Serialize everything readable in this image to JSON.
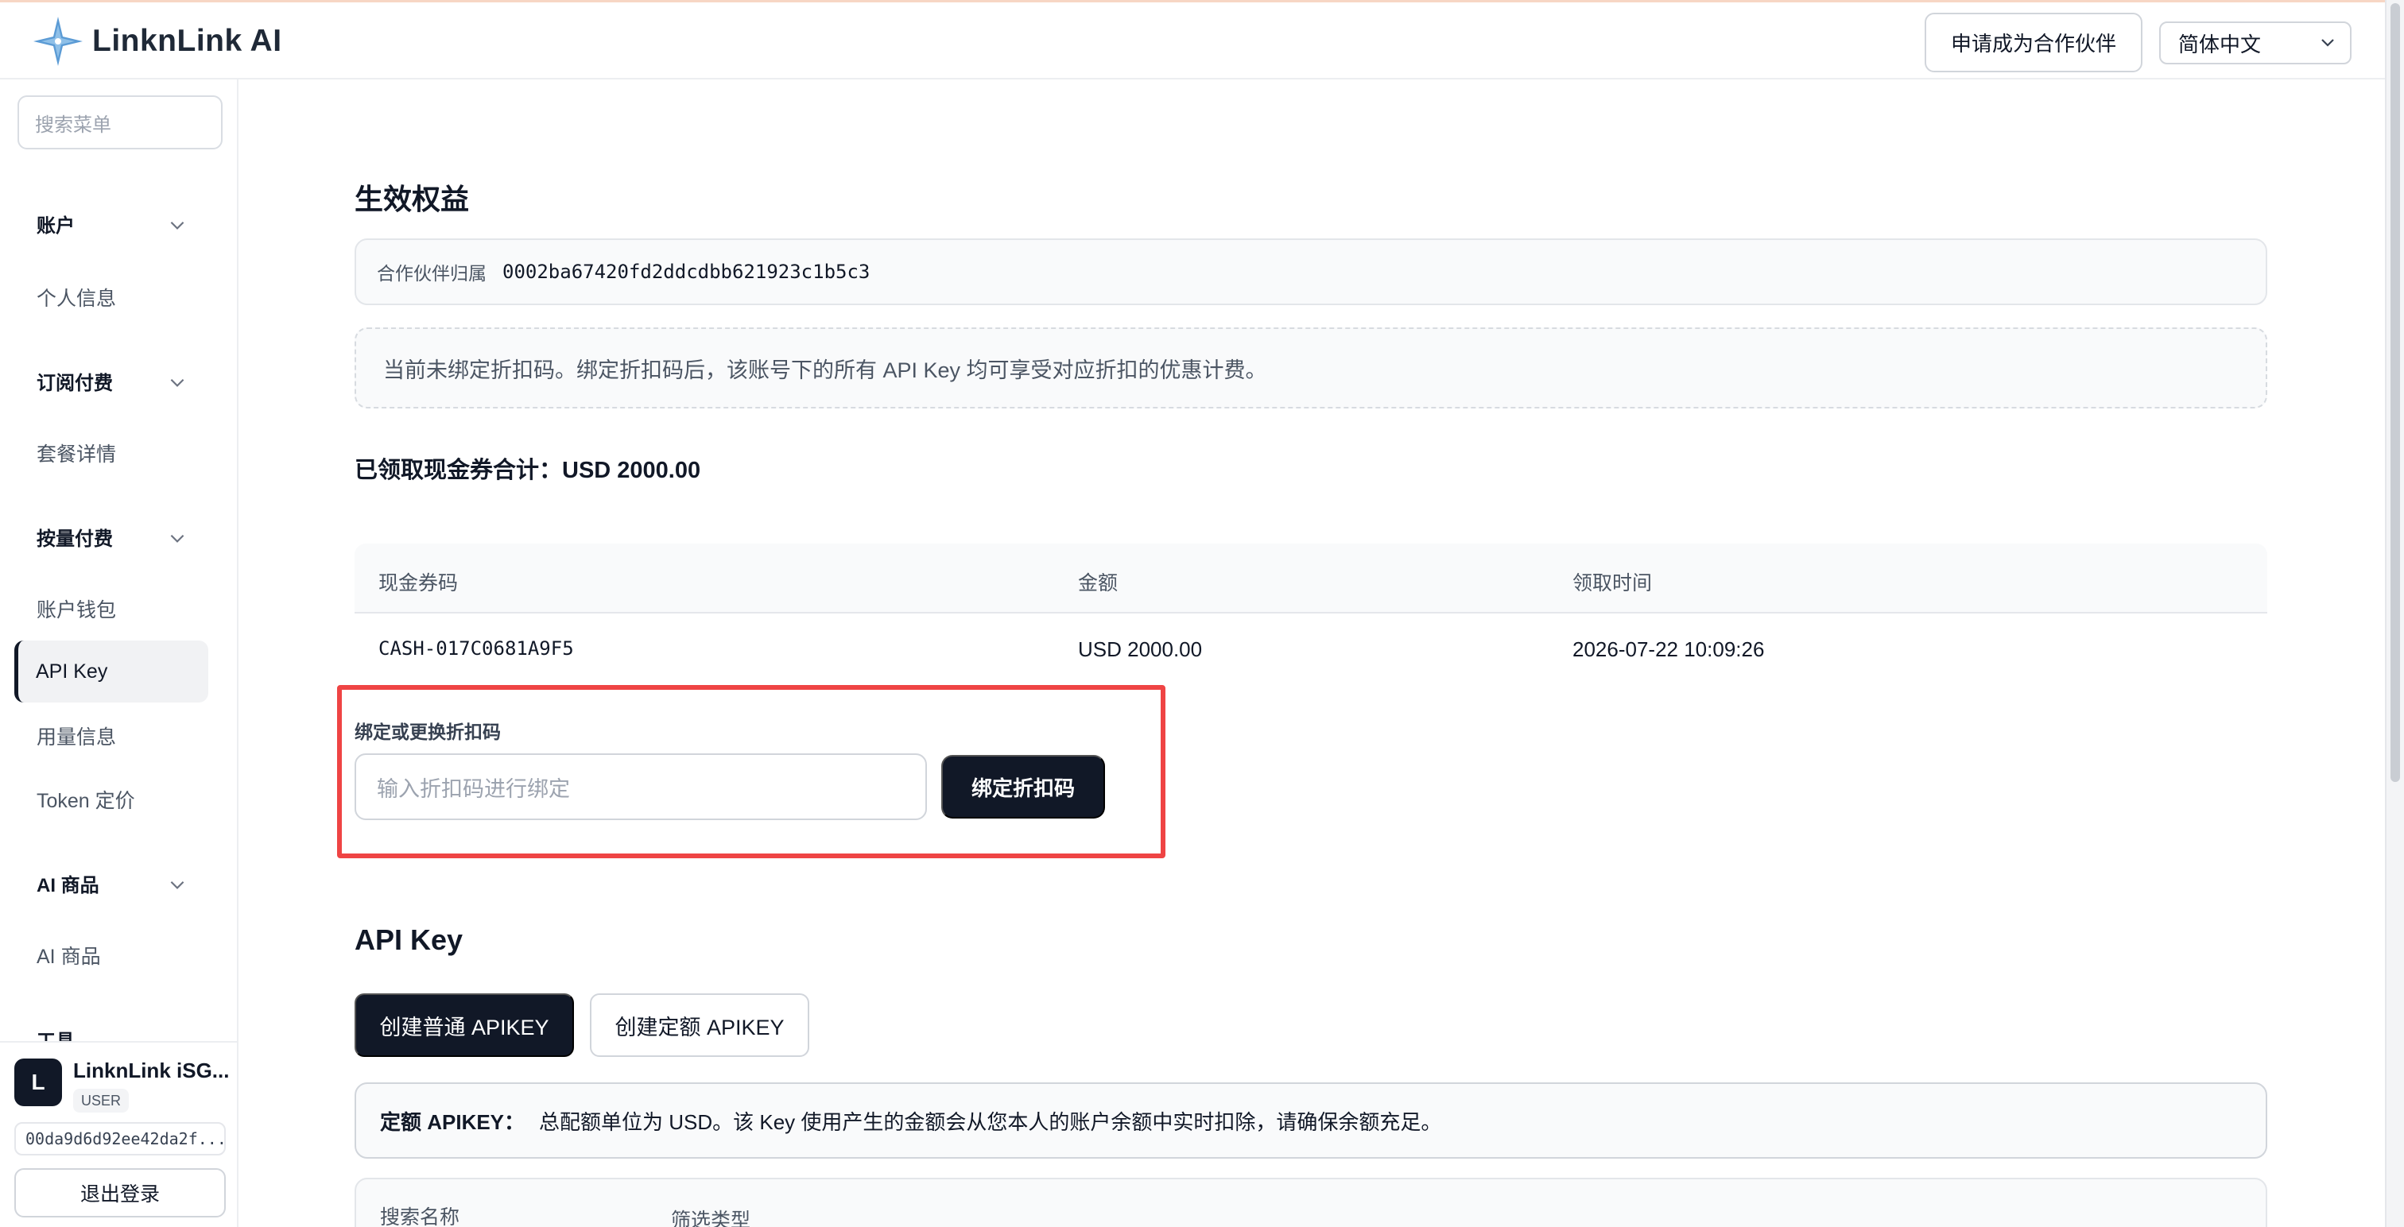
{
  "header": {
    "brand": "LinknLink AI",
    "partner_button": "申请成为合作伙伴",
    "language": "简体中文"
  },
  "sidebar": {
    "search_placeholder": "搜索菜单",
    "groups": [
      {
        "label": "账户",
        "items": [
          "个人信息"
        ]
      },
      {
        "label": "订阅付费",
        "items": [
          "套餐详情"
        ]
      },
      {
        "label": "按量付费",
        "items": [
          "账户钱包",
          "API Key",
          "用量信息",
          "Token 定价"
        ]
      },
      {
        "label": "AI 商品",
        "items": [
          "AI 商品"
        ]
      },
      {
        "label": "工具",
        "items": []
      }
    ],
    "active_item": "API Key",
    "user": {
      "initial": "L",
      "name": "LinknLink iSG...",
      "role": "USER",
      "id": "00da9d6d92ee42da2f...",
      "logout": "退出登录"
    }
  },
  "benefits": {
    "title": "生效权益",
    "partner_label": "合作伙伴归属",
    "partner_value": "0002ba67420fd2ddcdbb621923c1b5c3",
    "notice": "当前未绑定折扣码。绑定折扣码后，该账号下的所有 API Key 均可享受对应折扣的优惠计费。",
    "total": "已领取现金券合计：USD 2000.00",
    "table": {
      "headers": [
        "现金券码",
        "金额",
        "领取时间"
      ],
      "rows": [
        [
          "CASH-017C0681A9F5",
          "USD 2000.00",
          "2026-07-22 10:09:26"
        ]
      ]
    },
    "bind_label": "绑定或更换折扣码",
    "bind_placeholder": "输入折扣码进行绑定",
    "bind_button": "绑定折扣码"
  },
  "apikey": {
    "title": "API Key",
    "create_normal": "创建普通 APIKEY",
    "create_quota": "创建定额 APIKEY",
    "quota_note_label": "定额 APIKEY：",
    "quota_note": "总配额单位为 USD。该 Key 使用产生的金额会从您本人的账户余额中实时扣除，请确保余额充足。",
    "filter_name": "搜索名称",
    "filter_type": "筛选类型"
  },
  "colors": {
    "primary": "#111827",
    "highlight": "#ef4444",
    "logo_blue": "#5b9bd5"
  }
}
